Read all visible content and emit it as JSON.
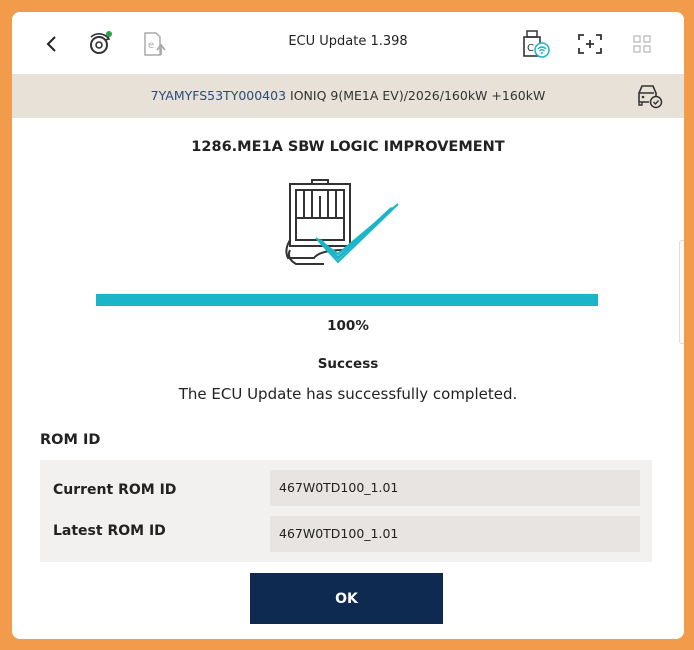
{
  "header": {
    "title": "ECU Update 1.398",
    "back_icon": "back-chevron-icon",
    "icons": [
      "diagnostic-gear-icon",
      "ecu-upload-icon",
      "vci-wireless-icon",
      "screen-capture-icon",
      "grid-menu-icon"
    ]
  },
  "vehicle": {
    "vin": "7YAMYFS53TY000403",
    "description": "IONIQ 9(ME1A EV)/2026/160kW +160kW"
  },
  "update": {
    "name": "1286.ME1A SBW LOGIC IMPROVEMENT",
    "progress_percent": 100,
    "progress_text": "100%",
    "status": "Success",
    "message": "The ECU Update has successfully completed."
  },
  "rom": {
    "heading": "ROM ID",
    "rows": [
      {
        "label": "Current ROM ID",
        "value": "467W0TD100_1.01"
      },
      {
        "label": "Latest ROM ID",
        "value": "467W0TD100_1.01"
      }
    ]
  },
  "actions": {
    "ok_label": "OK"
  },
  "colors": {
    "frame": "#f29b4b",
    "progress": "#1bb5c9",
    "button": "#0e2a50",
    "vehicle_bar": "#e8e1d8"
  }
}
